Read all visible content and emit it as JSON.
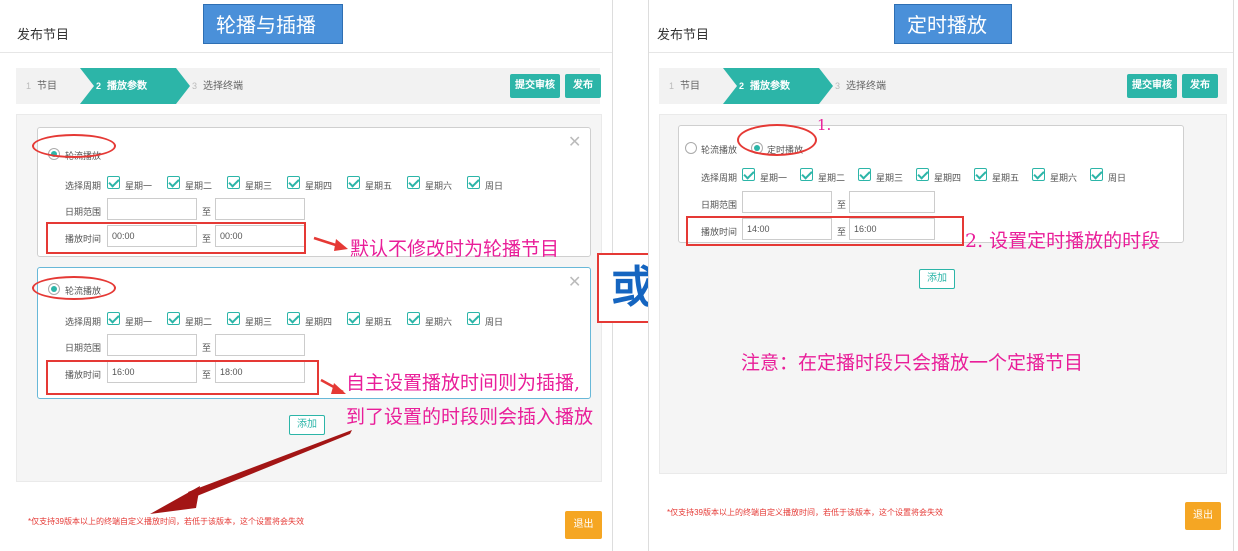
{
  "left": {
    "dialog_title": "发布节目",
    "caption": "轮播与插播",
    "steps": [
      {
        "num": "1",
        "label": "节目"
      },
      {
        "num": "2",
        "label": "播放参数"
      },
      {
        "num": "3",
        "label": "选择终端"
      }
    ],
    "buttons": {
      "submit_review": "提交审核",
      "publish": "发布",
      "add": "添加",
      "exit": "退出"
    },
    "cards": [
      {
        "mode_label": "轮流播放",
        "period_label": "选择周期",
        "weekdays": [
          "星期一",
          "星期二",
          "星期三",
          "星期四",
          "星期五",
          "星期六",
          "周日"
        ],
        "date_label": "日期范围",
        "date_to": "至",
        "date_from_value": "",
        "date_to_value": "",
        "time_label": "播放时间",
        "time_from": "00:00",
        "time_to_sep": "至",
        "time_to": "00:00"
      },
      {
        "mode_label": "轮流播放",
        "period_label": "选择周期",
        "weekdays": [
          "星期一",
          "星期二",
          "星期三",
          "星期四",
          "星期五",
          "星期六",
          "周日"
        ],
        "date_label": "日期范围",
        "date_to": "至",
        "date_from_value": "",
        "date_to_value": "",
        "time_label": "播放时间",
        "time_from": "16:00",
        "time_to_sep": "至",
        "time_to": "18:00"
      }
    ],
    "annotations": {
      "default_note": "默认不修改时为轮播节目",
      "custom_note_1": "自主设置播放时间则为插播,",
      "custom_note_2": "到了设置的时段则会插入播放"
    },
    "footer_note": "*仅支持39版本以上的终端自定义播放时间，若低于该版本，这个设置将会失效"
  },
  "or_label": "或",
  "right": {
    "dialog_title": "发布节目",
    "caption": "定时播放",
    "steps": [
      {
        "num": "1",
        "label": "节目"
      },
      {
        "num": "2",
        "label": "播放参数"
      },
      {
        "num": "3",
        "label": "选择终端"
      }
    ],
    "buttons": {
      "submit_review": "提交审核",
      "publish": "发布",
      "add": "添加",
      "exit": "退出"
    },
    "card": {
      "mode_rotate_label": "轮流播放",
      "mode_timed_label": "定时播放",
      "period_label": "选择周期",
      "weekdays": [
        "星期一",
        "星期二",
        "星期三",
        "星期四",
        "星期五",
        "星期六",
        "周日"
      ],
      "date_label": "日期范围",
      "date_to": "至",
      "date_from_value": "",
      "date_to_value": "",
      "time_label": "播放时间",
      "time_from": "14:00",
      "time_to_sep": "至",
      "time_to": "16:00"
    },
    "annotations": {
      "step1": "1.",
      "step2": "2. 设置定时播放的时段",
      "notice": "注意：在定播时段只会播放一个定播节目"
    },
    "footer_note": "*仅支持39版本以上的终端自定义播放时间，若低于该版本，这个设置将会失效"
  },
  "colors": {
    "teal": "#2cb5a8",
    "orange": "#f5a623",
    "annotation_red": "#e53935",
    "annotation_magenta": "#e91e99",
    "caption_blue": "#4a90d9",
    "or_blue": "#1565c0"
  }
}
